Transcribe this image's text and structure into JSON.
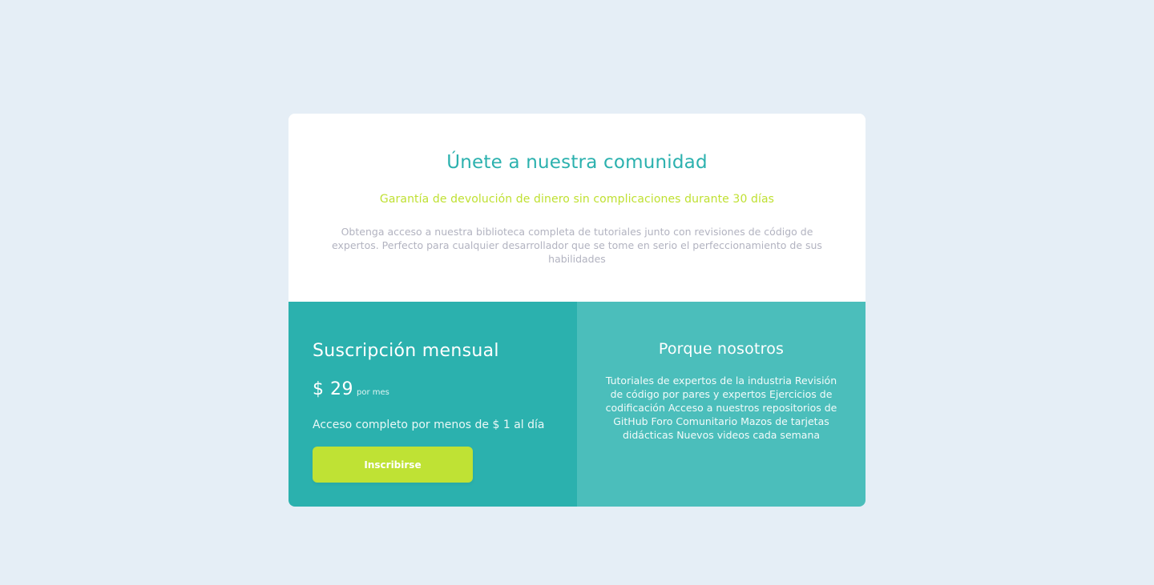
{
  "colors": {
    "background": "#e5eef6",
    "card": "#ffffff",
    "accent_teal": "#2bb1ae",
    "accent_teal_light": "#4bbebb",
    "accent_lime": "#bfe234",
    "muted_text": "#b2b3c0"
  },
  "header": {
    "title": "Únete a nuestra comunidad",
    "guarantee": "Garantía de devolución de dinero sin complicaciones durante 30 días",
    "description": "Obtenga acceso a nuestra biblioteca completa de tutoriales junto con revisiones de código de expertos. Perfecto para cualquier desarrollador que se tome en serio el perfeccionamiento de sus habilidades"
  },
  "subscription": {
    "title": "Suscripción mensual",
    "price": "$ 29",
    "period": "por mes",
    "access_text": "Acceso completo por menos de $ 1 al día",
    "button_label": "Inscribirse"
  },
  "why_us": {
    "title": "Porque nosotros",
    "text": "Tutoriales de expertos de la industria Revisión de código por pares y expertos Ejercicios de codificación Acceso a nuestros repositorios de GitHub Foro Comunitario Mazos de tarjetas didácticas Nuevos videos cada semana"
  }
}
